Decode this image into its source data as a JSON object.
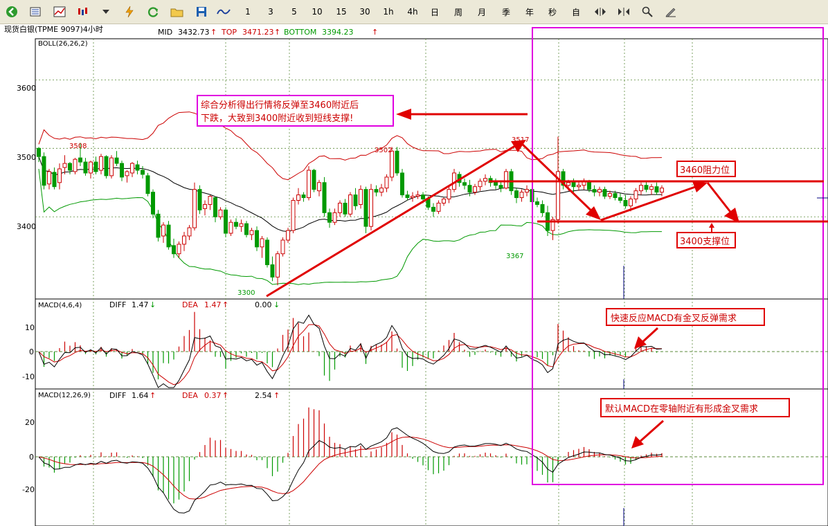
{
  "toolbar": {
    "periods": [
      "1",
      "3",
      "5",
      "10",
      "15",
      "30",
      "1h",
      "4h",
      "日",
      "周",
      "月",
      "季",
      "年",
      "秒",
      "自"
    ]
  },
  "header": {
    "symbol": "现货白银(TPME 9097)4小时",
    "mid_label": "MID",
    "mid_value": "3432.73",
    "top_label": "TOP",
    "top_value": "3471.23",
    "bottom_label": "BOTTOM",
    "bottom_value": "3394.23",
    "boll_params": "BOLL(26,26,2)"
  },
  "colors": {
    "up": "#cc0000",
    "down": "#009900",
    "mid": "#000000",
    "upper": "#cc0000",
    "lower": "#009900",
    "dea": "#cc0000",
    "diff": "#000000",
    "highlight": "#e000e0"
  },
  "price_axis": {
    "ticks": [
      "3600",
      "3500",
      "3400"
    ]
  },
  "macd1_axis": {
    "ticks": [
      "10",
      "0",
      "-10"
    ]
  },
  "macd2_axis": {
    "ticks": [
      "20",
      "0",
      "-20"
    ]
  },
  "macd1_header": {
    "params": "MACD(4,6,4)",
    "diff_label": "DIFF",
    "diff_value": "1.47",
    "dea_label": "DEA",
    "dea_value": "1.47",
    "macd_value": "0.00"
  },
  "macd2_header": {
    "params": "MACD(12,26,9)",
    "diff_label": "DIFF",
    "diff_value": "1.64",
    "dea_label": "DEA",
    "dea_value": "0.37",
    "macd_value": "2.54"
  },
  "annotations": {
    "analysis_line1": "综合分析得出行情将反弹至3460附近后",
    "analysis_line2": "下跌，大致到3400附近收到短线支撑!",
    "resistance": "3460阻力位",
    "support": "3400支撑位",
    "macd_fast_note": "快速反应MACD有金叉反弹需求",
    "macd_default_note": "默认MACD在零轴附近有形成金叉需求"
  },
  "price_labels": {
    "p3508": "3508",
    "p3502": "3502",
    "p3517": "3517",
    "p3367": "3367",
    "p3300": "3300"
  },
  "chart_data": {
    "type": "candlestick",
    "y_range": [
      3280,
      3660
    ],
    "ohlc": [
      [
        3500,
        3502,
        3480,
        3488
      ],
      [
        3488,
        3494,
        3440,
        3446
      ],
      [
        3448,
        3470,
        3440,
        3466
      ],
      [
        3465,
        3472,
        3440,
        3444
      ],
      [
        3450,
        3478,
        3440,
        3470
      ],
      [
        3472,
        3490,
        3462,
        3478
      ],
      [
        3478,
        3480,
        3462,
        3468
      ],
      [
        3466,
        3486,
        3462,
        3484
      ],
      [
        3486,
        3508,
        3474,
        3480
      ],
      [
        3480,
        3486,
        3460,
        3464
      ],
      [
        3464,
        3482,
        3456,
        3480
      ],
      [
        3480,
        3488,
        3462,
        3466
      ],
      [
        3468,
        3492,
        3462,
        3488
      ],
      [
        3488,
        3490,
        3456,
        3460
      ],
      [
        3460,
        3490,
        3456,
        3486
      ],
      [
        3486,
        3496,
        3474,
        3478
      ],
      [
        3478,
        3482,
        3452,
        3458
      ],
      [
        3460,
        3468,
        3450,
        3466
      ],
      [
        3464,
        3480,
        3458,
        3478
      ],
      [
        3476,
        3482,
        3462,
        3468
      ],
      [
        3468,
        3474,
        3456,
        3462
      ],
      [
        3460,
        3464,
        3430,
        3434
      ],
      [
        3436,
        3440,
        3398,
        3404
      ],
      [
        3404,
        3410,
        3364,
        3370
      ],
      [
        3372,
        3392,
        3362,
        3388
      ],
      [
        3388,
        3394,
        3352,
        3356
      ],
      [
        3358,
        3368,
        3340,
        3346
      ],
      [
        3346,
        3364,
        3340,
        3360
      ],
      [
        3360,
        3378,
        3350,
        3372
      ],
      [
        3372,
        3388,
        3366,
        3384
      ],
      [
        3384,
        3450,
        3380,
        3440
      ],
      [
        3440,
        3446,
        3404,
        3410
      ],
      [
        3412,
        3424,
        3402,
        3418
      ],
      [
        3418,
        3432,
        3410,
        3430
      ],
      [
        3428,
        3430,
        3392,
        3400
      ],
      [
        3400,
        3414,
        3396,
        3410
      ],
      [
        3410,
        3414,
        3370,
        3376
      ],
      [
        3376,
        3396,
        3372,
        3392
      ],
      [
        3392,
        3398,
        3382,
        3386
      ],
      [
        3386,
        3396,
        3378,
        3390
      ],
      [
        3390,
        3394,
        3370,
        3374
      ],
      [
        3374,
        3384,
        3366,
        3380
      ],
      [
        3380,
        3386,
        3350,
        3356
      ],
      [
        3356,
        3372,
        3340,
        3368
      ],
      [
        3366,
        3370,
        3326,
        3330
      ],
      [
        3330,
        3342,
        3306,
        3312
      ],
      [
        3312,
        3350,
        3300,
        3346
      ],
      [
        3346,
        3370,
        3342,
        3366
      ],
      [
        3366,
        3384,
        3362,
        3380
      ],
      [
        3380,
        3428,
        3376,
        3424
      ],
      [
        3424,
        3442,
        3418,
        3432
      ],
      [
        3432,
        3436,
        3422,
        3428
      ],
      [
        3428,
        3474,
        3424,
        3468
      ],
      [
        3468,
        3470,
        3436,
        3440
      ],
      [
        3438,
        3454,
        3430,
        3450
      ],
      [
        3450,
        3458,
        3400,
        3406
      ],
      [
        3406,
        3412,
        3384,
        3392
      ],
      [
        3392,
        3412,
        3388,
        3406
      ],
      [
        3406,
        3424,
        3400,
        3420
      ],
      [
        3420,
        3426,
        3400,
        3404
      ],
      [
        3404,
        3436,
        3400,
        3432
      ],
      [
        3432,
        3442,
        3410,
        3416
      ],
      [
        3418,
        3446,
        3412,
        3440
      ],
      [
        3440,
        3444,
        3376,
        3386
      ],
      [
        3386,
        3448,
        3380,
        3440
      ],
      [
        3440,
        3446,
        3430,
        3436
      ],
      [
        3436,
        3448,
        3430,
        3442
      ],
      [
        3442,
        3462,
        3436,
        3458
      ],
      [
        3458,
        3502,
        3452,
        3496
      ],
      [
        3496,
        3502,
        3460,
        3464
      ],
      [
        3464,
        3470,
        3428,
        3432
      ],
      [
        3432,
        3438,
        3424,
        3428
      ],
      [
        3428,
        3436,
        3422,
        3430
      ],
      [
        3430,
        3438,
        3426,
        3432
      ],
      [
        3432,
        3436,
        3420,
        3426
      ],
      [
        3426,
        3430,
        3410,
        3414
      ],
      [
        3414,
        3420,
        3400,
        3408
      ],
      [
        3408,
        3424,
        3404,
        3420
      ],
      [
        3420,
        3428,
        3416,
        3426
      ],
      [
        3426,
        3446,
        3420,
        3440
      ],
      [
        3440,
        3470,
        3436,
        3464
      ],
      [
        3462,
        3466,
        3444,
        3450
      ],
      [
        3450,
        3456,
        3440,
        3446
      ],
      [
        3446,
        3454,
        3430,
        3436
      ],
      [
        3436,
        3448,
        3432,
        3444
      ],
      [
        3444,
        3456,
        3438,
        3452
      ],
      [
        3452,
        3462,
        3446,
        3456
      ],
      [
        3456,
        3460,
        3444,
        3450
      ],
      [
        3450,
        3456,
        3440,
        3446
      ],
      [
        3446,
        3452,
        3436,
        3442
      ],
      [
        3442,
        3470,
        3440,
        3466
      ],
      [
        3466,
        3470,
        3432,
        3438
      ],
      [
        3438,
        3442,
        3420,
        3428
      ],
      [
        3428,
        3440,
        3422,
        3436
      ],
      [
        3436,
        3446,
        3430,
        3440
      ],
      [
        3440,
        3442,
        3416,
        3422
      ],
      [
        3422,
        3428,
        3414,
        3418
      ],
      [
        3418,
        3424,
        3400,
        3406
      ],
      [
        3406,
        3416,
        3372,
        3380
      ],
      [
        3380,
        3400,
        3366,
        3396
      ],
      [
        3396,
        3517,
        3390,
        3466
      ],
      [
        3466,
        3470,
        3440,
        3446
      ],
      [
        3446,
        3454,
        3438,
        3450
      ],
      [
        3450,
        3456,
        3436,
        3444
      ],
      [
        3444,
        3452,
        3438,
        3446
      ],
      [
        3446,
        3456,
        3440,
        3452
      ],
      [
        3452,
        3454,
        3436,
        3440
      ],
      [
        3440,
        3446,
        3430,
        3436
      ],
      [
        3436,
        3444,
        3430,
        3440
      ],
      [
        3440,
        3444,
        3426,
        3430
      ],
      [
        3430,
        3438,
        3426,
        3434
      ],
      [
        3434,
        3438,
        3424,
        3428
      ],
      [
        3428,
        3434,
        3420,
        3424
      ],
      [
        3424,
        3432,
        3412,
        3416
      ],
      [
        3416,
        3430,
        3408,
        3426
      ],
      [
        3426,
        3442,
        3420,
        3438
      ],
      [
        3438,
        3450,
        3432,
        3446
      ],
      [
        3446,
        3452,
        3436,
        3440
      ],
      [
        3440,
        3448,
        3432,
        3444
      ],
      [
        3444,
        3450,
        3432,
        3436
      ],
      [
        3436,
        3446,
        3430,
        3442
      ]
    ],
    "macd1_range": [
      -16,
      18
    ],
    "macd2_range": [
      -26,
      30
    ],
    "ylabel": ""
  }
}
